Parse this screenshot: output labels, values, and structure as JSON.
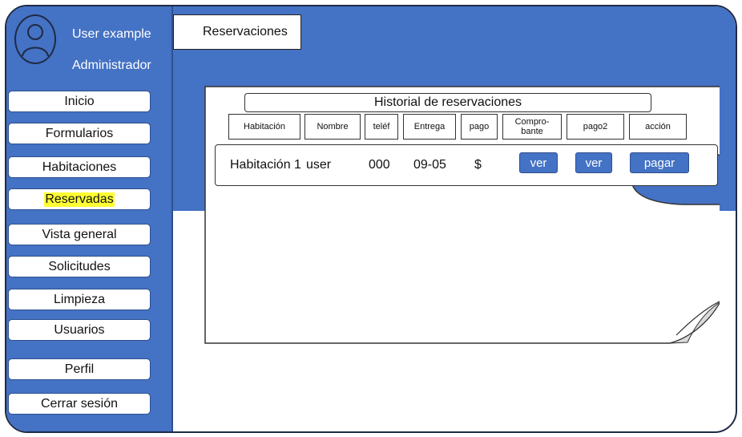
{
  "user": {
    "name": "User example",
    "role": "Administrador"
  },
  "sidebar": {
    "items": [
      {
        "label": "Inicio"
      },
      {
        "label": "Formularios"
      },
      {
        "label": "Habitaciones"
      },
      {
        "label": "Reservadas",
        "active": true
      },
      {
        "label": "Vista general"
      },
      {
        "label": "Solicitudes"
      },
      {
        "label": "Limpieza"
      },
      {
        "label": "Usuarios"
      },
      {
        "label": "Perfil"
      },
      {
        "label": "Cerrar sesión"
      }
    ]
  },
  "header": {
    "title": "Reservaciones"
  },
  "table": {
    "title": "Historial de reservaciones",
    "columns": [
      "Habitación",
      "Nombre",
      "teléf",
      "Entrega",
      "pago",
      "Compro-\nbante",
      "pago2",
      "acción"
    ],
    "rows": [
      {
        "habitacion": "Habitación 1",
        "nombre": "user",
        "telefono": "000",
        "entrega": "09-05",
        "pago": "$",
        "comprobante_button": "ver",
        "pago2_button": "ver",
        "accion_button": "pagar"
      }
    ]
  },
  "colors": {
    "accent": "#4472c4",
    "highlight": "#ffff33",
    "border": "#1f2a44"
  },
  "icons": {
    "avatar": "user-avatar-icon"
  }
}
